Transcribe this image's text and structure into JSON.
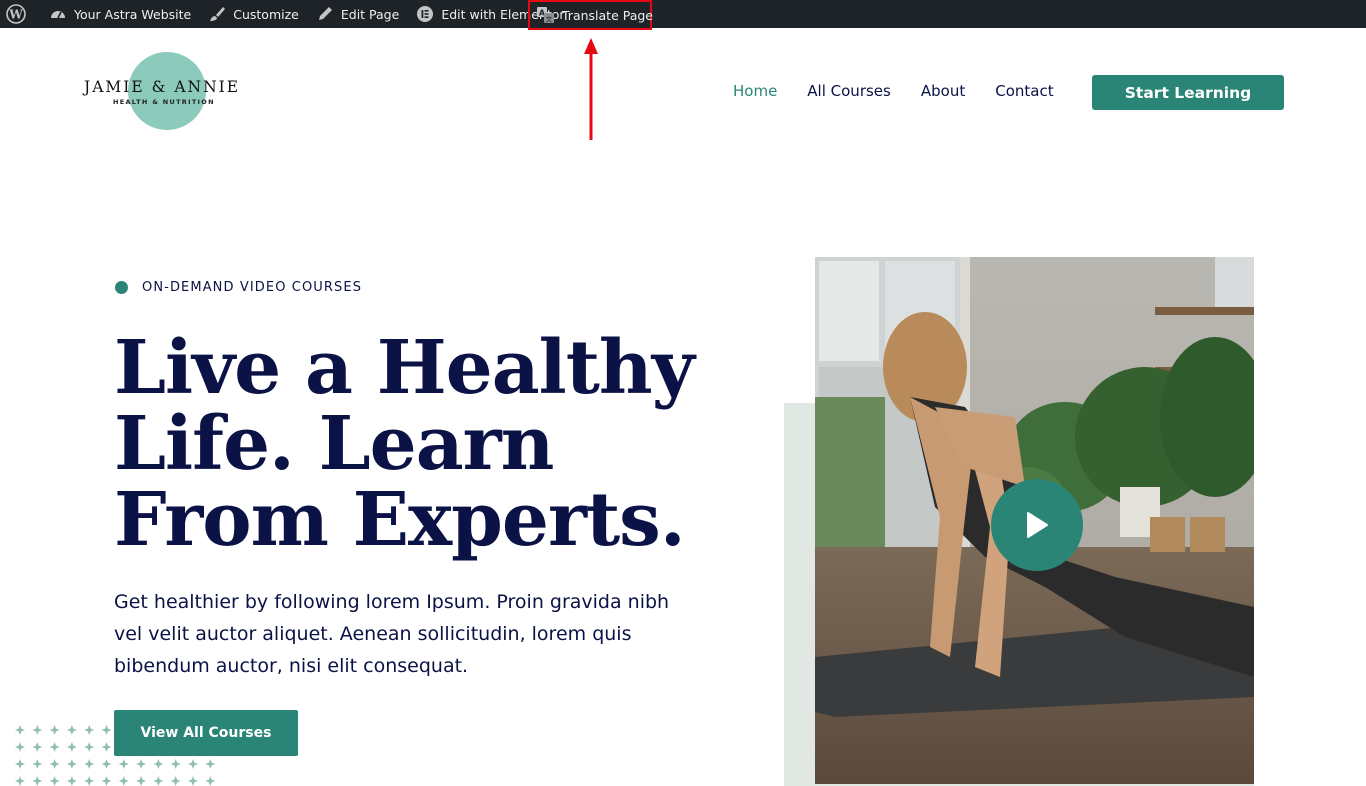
{
  "adminbar": {
    "items": [
      {
        "label": "Your Astra Website",
        "icon": "dashboard-icon"
      },
      {
        "label": "Customize",
        "icon": "paintbrush-icon"
      },
      {
        "label": "Edit Page",
        "icon": "pencil-icon"
      },
      {
        "label": "Edit with Elementor",
        "icon": "elementor-icon"
      },
      {
        "label": "Translate Page",
        "icon": "translate-icon"
      }
    ],
    "highlight_color": "#e50914"
  },
  "logo": {
    "title": "JAMIE & ANNIE",
    "subtitle": "HEALTH & NUTRITION"
  },
  "nav": {
    "items": [
      "Home",
      "All Courses",
      "About",
      "Contact"
    ],
    "active": "Home"
  },
  "header_cta": "Start Learning",
  "hero": {
    "eyebrow": "ON-DEMAND VIDEO COURSES",
    "title_lines": [
      "Live a Healthy",
      "Life. Learn",
      "From Experts."
    ],
    "description": "Get healthier by following lorem Ipsum. Proin gravida nibh vel velit auctor aliquet. Aenean sollicitudin, lorem quis bibendum auctor, nisi elit consequat.",
    "cta": "View All Courses"
  },
  "colors": {
    "accent": "#2a8577",
    "navy": "#0b1246",
    "adminbar": "#1d2327",
    "logo_circle": "#8ccabb"
  }
}
